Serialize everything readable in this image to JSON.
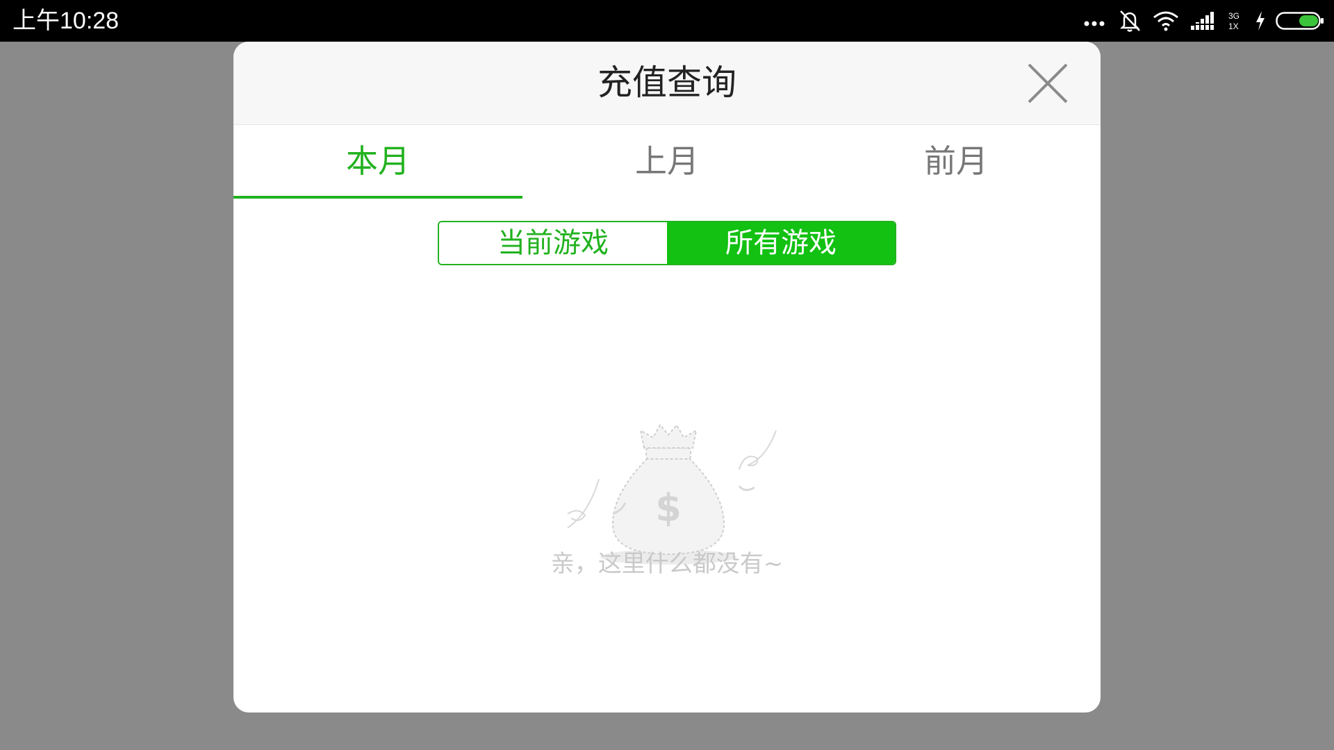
{
  "status_bar": {
    "time": "上午10:28",
    "network": "3G\n1X",
    "icons": [
      "more-dots-icon",
      "mute-bell-icon",
      "wifi-icon",
      "signal-icon",
      "network-3g-1x-icon",
      "charging-icon",
      "battery-icon"
    ]
  },
  "dialog": {
    "title": "充值查询",
    "close_icon": "close-icon",
    "tabs": [
      {
        "label": "本月",
        "active": true
      },
      {
        "label": "上月",
        "active": false
      },
      {
        "label": "前月",
        "active": false
      }
    ],
    "segment": {
      "options": [
        "当前游戏",
        "所有游戏"
      ],
      "selected_index": 1
    },
    "empty_state": {
      "icon": "money-bag-icon",
      "message": "亲，这里什么都没有~"
    }
  },
  "colors": {
    "accent_green": "#22b21f",
    "segment_fill": "#12c112",
    "backdrop": "#8a8a8a",
    "header_bg": "#f7f7f7"
  }
}
